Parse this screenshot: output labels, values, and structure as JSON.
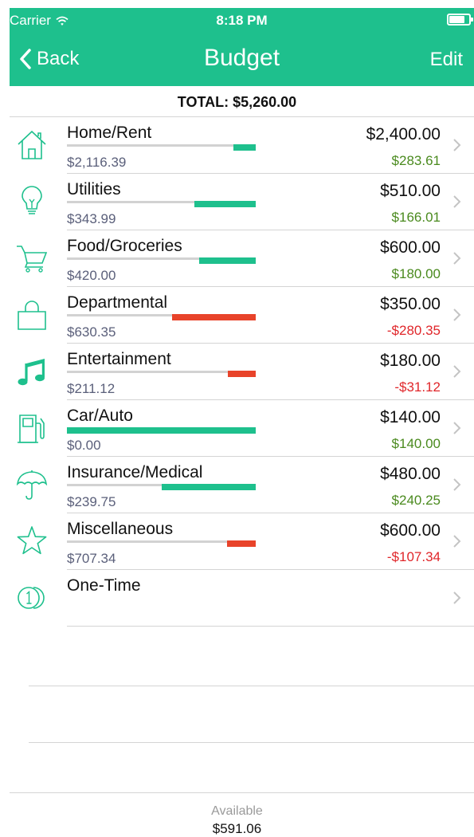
{
  "status": {
    "carrier": "Carrier",
    "time": "8:18 PM"
  },
  "nav": {
    "back_label": "Back",
    "title": "Budget",
    "edit_label": "Edit"
  },
  "total": "TOTAL: $5,260.00",
  "colors": {
    "brand": "#1ec08d",
    "bar_used": "#d2d2d2",
    "bar_remaining": "#1ec08d",
    "bar_over": "#e8432a",
    "remaining_positive": "#4a8a1e",
    "remaining_negative": "#e0262a"
  },
  "categories": [
    {
      "name": "Home/Rent",
      "icon": "house-icon",
      "budget": "$2,400.00",
      "spent": "$2,116.39",
      "remaining": "$283.61",
      "over": false,
      "used_fraction": 0.882
    },
    {
      "name": "Utilities",
      "icon": "lightbulb-icon",
      "budget": "$510.00",
      "spent": "$343.99",
      "remaining": "$166.01",
      "over": false,
      "used_fraction": 0.674
    },
    {
      "name": "Food/Groceries",
      "icon": "cart-icon",
      "budget": "$600.00",
      "spent": "$420.00",
      "remaining": "$180.00",
      "over": false,
      "used_fraction": 0.7
    },
    {
      "name": "Departmental",
      "icon": "shopping-bag-icon",
      "budget": "$350.00",
      "spent": "$630.35",
      "remaining": "-$280.35",
      "over": true,
      "used_fraction": 0.555
    },
    {
      "name": "Entertainment",
      "icon": "music-note-icon",
      "budget": "$180.00",
      "spent": "$211.12",
      "remaining": "-$31.12",
      "over": true,
      "used_fraction": 0.853
    },
    {
      "name": "Car/Auto",
      "icon": "fuel-pump-icon",
      "budget": "$140.00",
      "spent": "$0.00",
      "remaining": "$140.00",
      "over": false,
      "used_fraction": 0.0
    },
    {
      "name": "Insurance/Medical",
      "icon": "umbrella-icon",
      "budget": "$480.00",
      "spent": "$239.75",
      "remaining": "$240.25",
      "over": false,
      "used_fraction": 0.5
    },
    {
      "name": "Miscellaneous",
      "icon": "star-icon",
      "budget": "$600.00",
      "spent": "$707.34",
      "remaining": "-$107.34",
      "over": true,
      "used_fraction": 0.848
    },
    {
      "name": "One-Time",
      "icon": "coin-icon",
      "budget": "",
      "spent": "",
      "remaining": "",
      "over": false,
      "used_fraction": null
    }
  ],
  "footer": {
    "available_label": "Available",
    "available_value": "$591.06"
  }
}
